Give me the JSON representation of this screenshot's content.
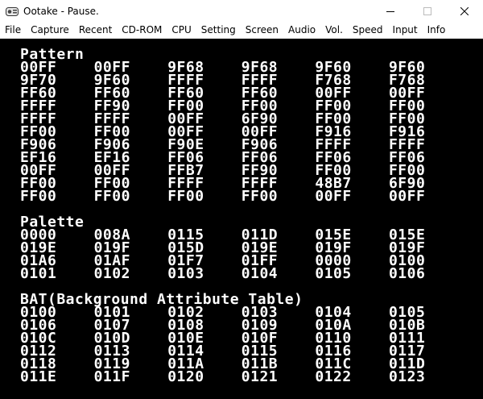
{
  "window": {
    "title": "Ootake - Pause.",
    "minimize_glyph": "—",
    "maximize_glyph": "☐",
    "close_glyph": "✕"
  },
  "menu": [
    "File",
    "Capture",
    "Recent",
    "CD-ROM",
    "CPU",
    "Setting",
    "Screen",
    "Audio",
    "Vol.",
    "Speed",
    "Input",
    "Info"
  ],
  "sections": {
    "pattern": {
      "title": "Pattern",
      "rows": [
        [
          "00FF",
          "00FF",
          "9F68",
          "9F68",
          "9F60",
          "9F60"
        ],
        [
          "9F70",
          "9F60",
          "FFFF",
          "FFFF",
          "F768",
          "F768"
        ],
        [
          "FF60",
          "FF60",
          "FF60",
          "FF60",
          "00FF",
          "00FF"
        ],
        [
          "FFFF",
          "FF90",
          "FF00",
          "FF00",
          "FF00",
          "FF00"
        ],
        [
          "FFFF",
          "FFFF",
          "00FF",
          "6F90",
          "FF00",
          "FF00"
        ],
        [
          "FF00",
          "FF00",
          "00FF",
          "00FF",
          "F916",
          "F916"
        ],
        [
          "F906",
          "F906",
          "F90E",
          "F906",
          "FFFF",
          "FFFF"
        ],
        [
          "EF16",
          "EF16",
          "FF06",
          "FF06",
          "FF06",
          "FF06"
        ],
        [
          "00FF",
          "00FF",
          "FFB7",
          "FF90",
          "FF00",
          "FF00"
        ],
        [
          "FF00",
          "FF00",
          "FFFF",
          "FFFF",
          "48B7",
          "6F90"
        ],
        [
          "FF00",
          "FF00",
          "FF00",
          "FF00",
          "00FF",
          "00FF"
        ]
      ]
    },
    "palette": {
      "title": "Palette",
      "rows": [
        [
          "0000",
          "008A",
          "0115",
          "011D",
          "015E",
          "015E"
        ],
        [
          "019E",
          "019F",
          "015D",
          "019E",
          "019F",
          "019F"
        ],
        [
          "01A6",
          "01AF",
          "01F7",
          "01FF",
          "0000",
          "0100"
        ],
        [
          "0101",
          "0102",
          "0103",
          "0104",
          "0105",
          "0106"
        ]
      ]
    },
    "bat": {
      "title": "BAT(Background Attribute Table)",
      "rows": [
        [
          "0100",
          "0101",
          "0102",
          "0103",
          "0104",
          "0105"
        ],
        [
          "0106",
          "0107",
          "0108",
          "0109",
          "010A",
          "010B"
        ],
        [
          "010C",
          "010D",
          "010E",
          "010F",
          "0110",
          "0111"
        ],
        [
          "0112",
          "0113",
          "0114",
          "0115",
          "0116",
          "0117"
        ],
        [
          "0118",
          "0119",
          "011A",
          "011B",
          "011C",
          "011D"
        ],
        [
          "011E",
          "011F",
          "0120",
          "0121",
          "0122",
          "0123"
        ]
      ]
    }
  }
}
